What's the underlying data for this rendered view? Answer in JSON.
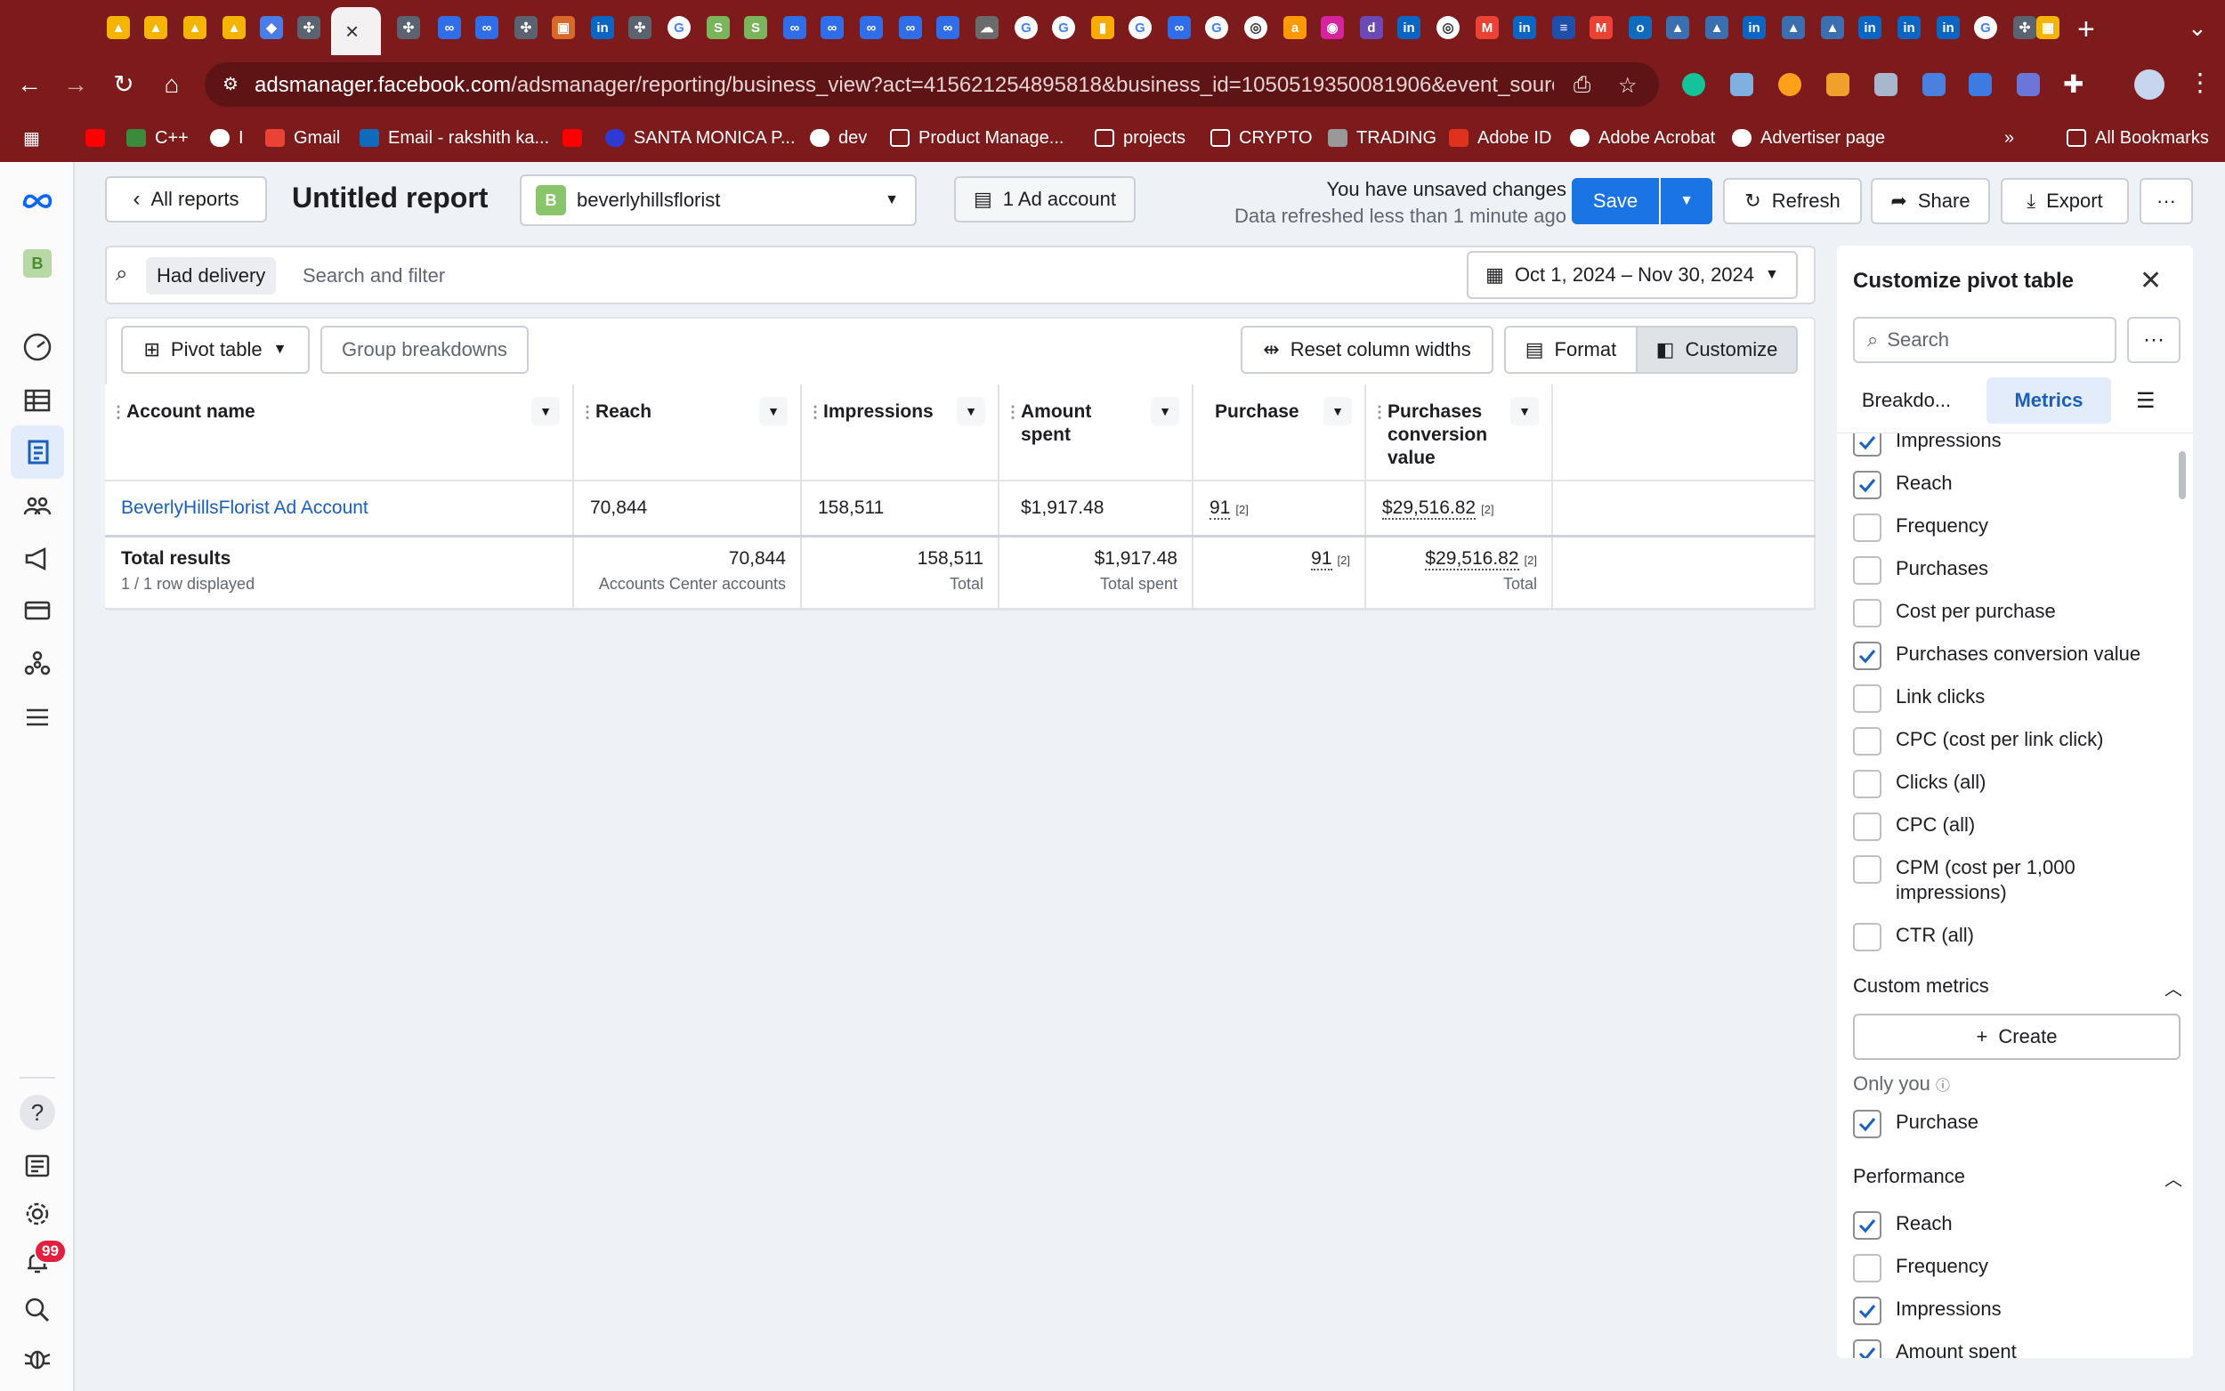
{
  "browser": {
    "active_tab_close": "×",
    "new_tab": "+",
    "url_host": "adsmanager.facebook.com",
    "url_path": "/adsmanager/reporting/business_view?act=415621254895818&business_id=1050519350081906&event_source=AUTO...",
    "bookmarks": [
      {
        "label": "C++"
      },
      {
        "label": "I"
      },
      {
        "label": "Gmail"
      },
      {
        "label": "Email - rakshith ka..."
      },
      {
        "label": "SANTA MONICA P..."
      },
      {
        "label": "dev"
      },
      {
        "label": "Product Manage..."
      },
      {
        "label": "projects"
      },
      {
        "label": "CRYPTO"
      },
      {
        "label": "TRADING"
      },
      {
        "label": "Adobe ID"
      },
      {
        "label": "Adobe Acrobat"
      },
      {
        "label": "Advertiser page"
      },
      {
        "label": "All Bookmarks"
      }
    ]
  },
  "leftnav": {
    "account_initial": "B",
    "notification_count": "99"
  },
  "header": {
    "back_label": "All reports",
    "title": "Untitled report",
    "account_initial": "B",
    "account_name": "beverlyhillsflorist",
    "ad_accounts": "1 Ad account",
    "unsaved": "You have unsaved changes",
    "refreshed": "Data refreshed less than 1 minute ago",
    "save": "Save",
    "refresh": "Refresh",
    "share": "Share",
    "export": "Export"
  },
  "filter": {
    "chip": "Had delivery",
    "placeholder": "Search and filter",
    "date_range": "Oct 1, 2024 – Nov 30, 2024"
  },
  "table_toolbar": {
    "view": "Pivot table",
    "group": "Group breakdowns",
    "reset": "Reset column widths",
    "format": "Format",
    "customize": "Customize"
  },
  "table": {
    "columns": [
      "Account name",
      "Reach",
      "Impressions",
      "Amount spent",
      "Purchase",
      "Purchases conversion value"
    ],
    "rows": [
      {
        "account": "BeverlyHillsFlorist Ad Account",
        "reach": "70,844",
        "impressions": "158,511",
        "spent": "$1,917.48",
        "purchase": "91",
        "purchase_fn": "[2]",
        "value": "$29,516.82",
        "value_fn": "[2]"
      }
    ],
    "total": {
      "label": "Total results",
      "sub": "1 / 1 row displayed",
      "reach": "70,844",
      "reach_sub": "Accounts Center accounts",
      "impressions": "158,511",
      "impressions_sub": "Total",
      "spent": "$1,917.48",
      "spent_sub": "Total spent",
      "purchase": "91",
      "purchase_fn": "[2]",
      "value": "$29,516.82",
      "value_fn": "[2]",
      "value_sub": "Total"
    }
  },
  "customize": {
    "title": "Customize pivot table",
    "search_placeholder": "Search",
    "tab_breakdowns": "Breakdo...",
    "tab_metrics": "Metrics",
    "metrics": [
      {
        "label": "Impressions",
        "checked": true
      },
      {
        "label": "Reach",
        "checked": true
      },
      {
        "label": "Frequency",
        "checked": false
      },
      {
        "label": "Purchases",
        "checked": false
      },
      {
        "label": "Cost per purchase",
        "checked": false
      },
      {
        "label": "Purchases conversion value",
        "checked": true
      },
      {
        "label": "Link clicks",
        "checked": false
      },
      {
        "label": "CPC (cost per link click)",
        "checked": false
      },
      {
        "label": "Clicks (all)",
        "checked": false
      },
      {
        "label": "CPC (all)",
        "checked": false
      },
      {
        "label": "CPM (cost per 1,000 impressions)",
        "checked": false
      },
      {
        "label": "CTR (all)",
        "checked": false
      }
    ],
    "custom_metrics_heading": "Custom metrics",
    "create": "Create",
    "only_you": "Only you",
    "custom_items": [
      {
        "label": "Purchase",
        "checked": true
      }
    ],
    "performance_heading": "Performance",
    "performance_items": [
      {
        "label": "Reach",
        "checked": true
      },
      {
        "label": "Frequency",
        "checked": false
      },
      {
        "label": "Impressions",
        "checked": true
      },
      {
        "label": "Amount spent",
        "checked": true
      }
    ]
  }
}
